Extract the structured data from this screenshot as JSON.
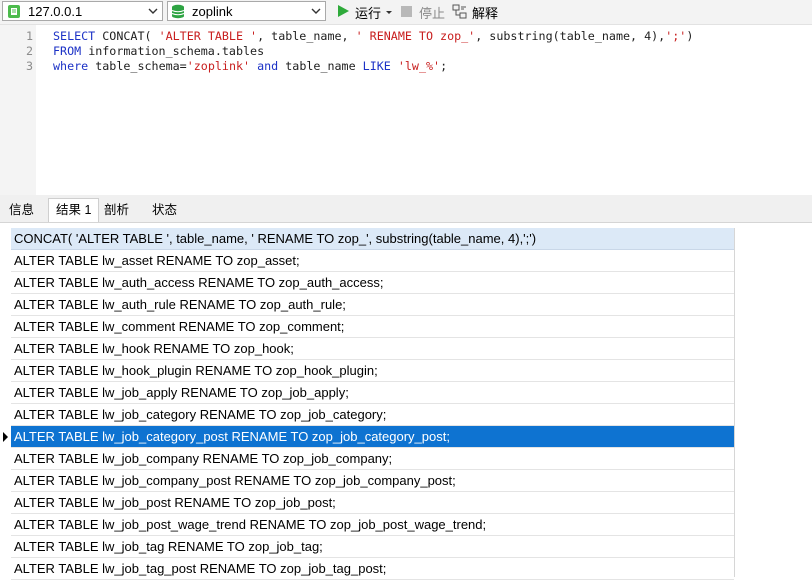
{
  "toolbar": {
    "connection": "127.0.0.1",
    "database": "zoplink",
    "run_label": "运行",
    "stop_label": "停止",
    "explain_label": "解释",
    "colors": {
      "run": "#2eaa3a",
      "db": "#2ea443",
      "conn": "#4cbb4c"
    },
    "icons": [
      "connection-icon",
      "database-icon",
      "run-icon",
      "stop-icon",
      "explain-icon",
      "chevron-down-icon"
    ]
  },
  "editor": {
    "lines": [
      {
        "num": "1",
        "tokens": [
          {
            "t": "SELECT ",
            "c": "kw"
          },
          {
            "t": "CONCAT( ",
            "c": "plain"
          },
          {
            "t": "'ALTER TABLE '",
            "c": "str"
          },
          {
            "t": ", table_name, ",
            "c": "plain"
          },
          {
            "t": "' RENAME TO zop_'",
            "c": "str"
          },
          {
            "t": ", substring(table_name, 4),",
            "c": "plain"
          },
          {
            "t": "';'",
            "c": "str"
          },
          {
            "t": ")",
            "c": "plain"
          }
        ]
      },
      {
        "num": "2",
        "tokens": [
          {
            "t": "FROM ",
            "c": "kw"
          },
          {
            "t": "information_schema.tables",
            "c": "plain"
          }
        ]
      },
      {
        "num": "3",
        "tokens": [
          {
            "t": "where ",
            "c": "kw"
          },
          {
            "t": "table_schema=",
            "c": "plain"
          },
          {
            "t": "'zoplink'",
            "c": "str"
          },
          {
            "t": " ",
            "c": "plain"
          },
          {
            "t": "and ",
            "c": "kw"
          },
          {
            "t": "table_name ",
            "c": "plain"
          },
          {
            "t": "LIKE ",
            "c": "kw"
          },
          {
            "t": "'lw_%'",
            "c": "str"
          },
          {
            "t": ";",
            "c": "plain"
          }
        ]
      }
    ]
  },
  "tabs": [
    {
      "label": "信息",
      "active": false
    },
    {
      "label": "结果 1",
      "active": true
    },
    {
      "label": "剖析",
      "active": false
    },
    {
      "label": "状态",
      "active": false
    }
  ],
  "grid": {
    "column_header": "CONCAT( 'ALTER TABLE ', table_name, ' RENAME TO zop_', substring(table_name, 4),';')",
    "selected_row_index": 8,
    "colors": {
      "header_bg": "#dce9f7",
      "selected_bg": "#0e73d1"
    },
    "rows": [
      "ALTER TABLE lw_asset RENAME TO zop_asset;",
      "ALTER TABLE lw_auth_access RENAME TO zop_auth_access;",
      "ALTER TABLE lw_auth_rule RENAME TO zop_auth_rule;",
      "ALTER TABLE lw_comment RENAME TO zop_comment;",
      "ALTER TABLE lw_hook RENAME TO zop_hook;",
      "ALTER TABLE lw_hook_plugin RENAME TO zop_hook_plugin;",
      "ALTER TABLE lw_job_apply RENAME TO zop_job_apply;",
      "ALTER TABLE lw_job_category RENAME TO zop_job_category;",
      "ALTER TABLE lw_job_category_post RENAME TO zop_job_category_post;",
      "ALTER TABLE lw_job_company RENAME TO zop_job_company;",
      "ALTER TABLE lw_job_company_post RENAME TO zop_job_company_post;",
      "ALTER TABLE lw_job_post RENAME TO zop_job_post;",
      "ALTER TABLE lw_job_post_wage_trend RENAME TO zop_job_post_wage_trend;",
      "ALTER TABLE lw_job_tag RENAME TO zop_job_tag;",
      "ALTER TABLE lw_job_tag_post RENAME TO zop_job_tag_post;"
    ]
  }
}
